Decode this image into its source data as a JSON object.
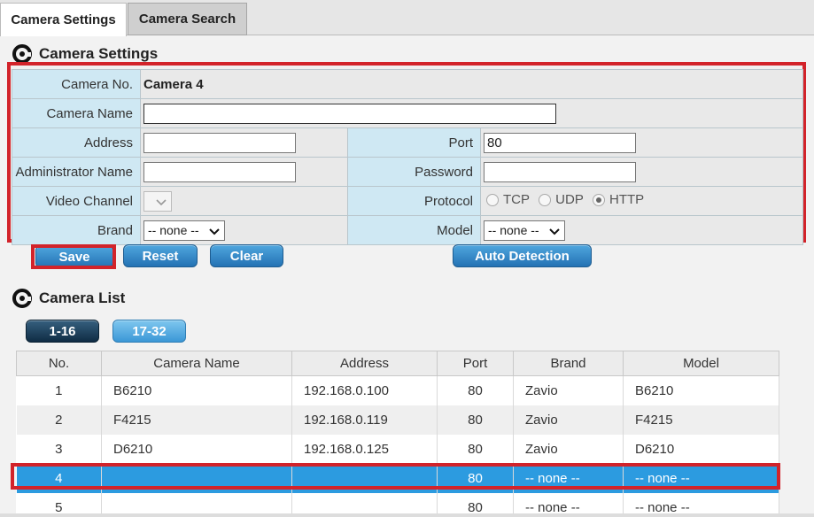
{
  "tabs": [
    {
      "label": "Camera Settings"
    },
    {
      "label": "Camera Search"
    }
  ],
  "settings": {
    "heading": "Camera Settings",
    "camera_no_label": "Camera No.",
    "camera_no_value": "Camera 4",
    "camera_name_label": "Camera Name",
    "camera_name_value": "",
    "address_label": "Address",
    "address_value": "",
    "port_label": "Port",
    "port_value": "80",
    "admin_label": "Administrator Name",
    "admin_value": "",
    "password_label": "Password",
    "password_value": "",
    "video_channel_label": "Video Channel",
    "video_channel_value": "",
    "protocol_label": "Protocol",
    "protocol_options": [
      {
        "label": "TCP",
        "selected": false
      },
      {
        "label": "UDP",
        "selected": false
      },
      {
        "label": "HTTP",
        "selected": true
      }
    ],
    "brand_label": "Brand",
    "brand_value": "-- none --",
    "model_label": "Model",
    "model_value": "-- none --"
  },
  "buttons": {
    "save": "Save",
    "reset": "Reset",
    "clear": "Clear",
    "auto_detection": "Auto Detection"
  },
  "camera_list": {
    "heading": "Camera List",
    "pages": [
      "1-16",
      "17-32"
    ],
    "active_page": "1-16",
    "columns": [
      "No.",
      "Camera Name",
      "Address",
      "Port",
      "Brand",
      "Model"
    ],
    "rows": [
      {
        "no": "1",
        "name": "B6210",
        "address": "192.168.0.100",
        "port": "80",
        "brand": "Zavio",
        "model": "B6210"
      },
      {
        "no": "2",
        "name": "F4215",
        "address": "192.168.0.119",
        "port": "80",
        "brand": "Zavio",
        "model": "F4215"
      },
      {
        "no": "3",
        "name": "D6210",
        "address": "192.168.0.125",
        "port": "80",
        "brand": "Zavio",
        "model": "D6210"
      },
      {
        "no": "4",
        "name": "",
        "address": "",
        "port": "80",
        "brand": "-- none --",
        "model": "-- none --"
      },
      {
        "no": "5",
        "name": "",
        "address": "",
        "port": "80",
        "brand": "-- none --",
        "model": "-- none --"
      }
    ],
    "selected_row": "4"
  },
  "colors": {
    "highlight_red": "#d2232a",
    "selected_row": "#2c9be0",
    "label_cell": "#cfe8f3",
    "button_blue": "#2472b4"
  }
}
